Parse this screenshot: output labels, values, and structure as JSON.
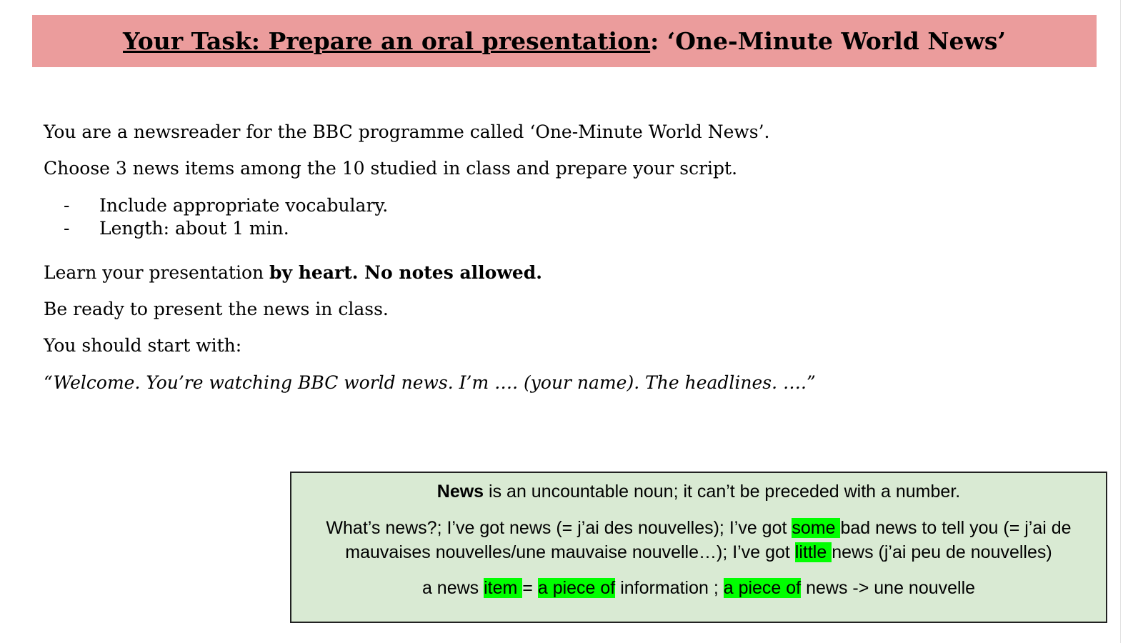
{
  "title": {
    "underlined": "Your Task:  Prepare an oral presentation",
    "rest": ": ‘One-Minute World News’"
  },
  "body": {
    "intro": "You are a newsreader for the BBC programme called ‘One-Minute World News’.",
    "choose": "Choose 3 news items among the 10 studied in class and prepare your script.",
    "bullets": [
      {
        "dash": "-",
        "text": "Include appropriate vocabulary."
      },
      {
        "dash": "-",
        "text": "Length: about 1 min."
      }
    ],
    "learn_prefix": "Learn your presentation ",
    "learn_bold": "by heart. No notes allowed.",
    "ready": "Be ready to present the news in class.",
    "start": "You should start with:",
    "quote": "“Welcome. You’re watching BBC world news. I’m …. (your name). The headlines. ….”"
  },
  "note": {
    "line1_bold": "News",
    "line1_rest": " is an uncountable noun; it can’t be preceded with a number.",
    "line2_a": "What’s news?; I’ve got news (= j’ai des nouvelles); I’ve got ",
    "line2_hl": "some ",
    "line2_b": "bad news to tell you (= j’ai de",
    "line3_a": "mauvaises nouvelles/une mauvaise nouvelle…); I’ve got ",
    "line3_hl": "little ",
    "line3_b": "news (j’ai peu de nouvelles)",
    "line4_a": "a news ",
    "line4_hl1": "item ",
    "line4_b": "= ",
    "line4_hl2": "a piece of",
    "line4_c": " information ; ",
    "line4_hl3": "a piece of",
    "line4_d": " news -> une nouvelle",
    "highlight_color": "#00ff00",
    "box_color": "#d9ead3"
  },
  "banner_color": "#eb9c9c"
}
